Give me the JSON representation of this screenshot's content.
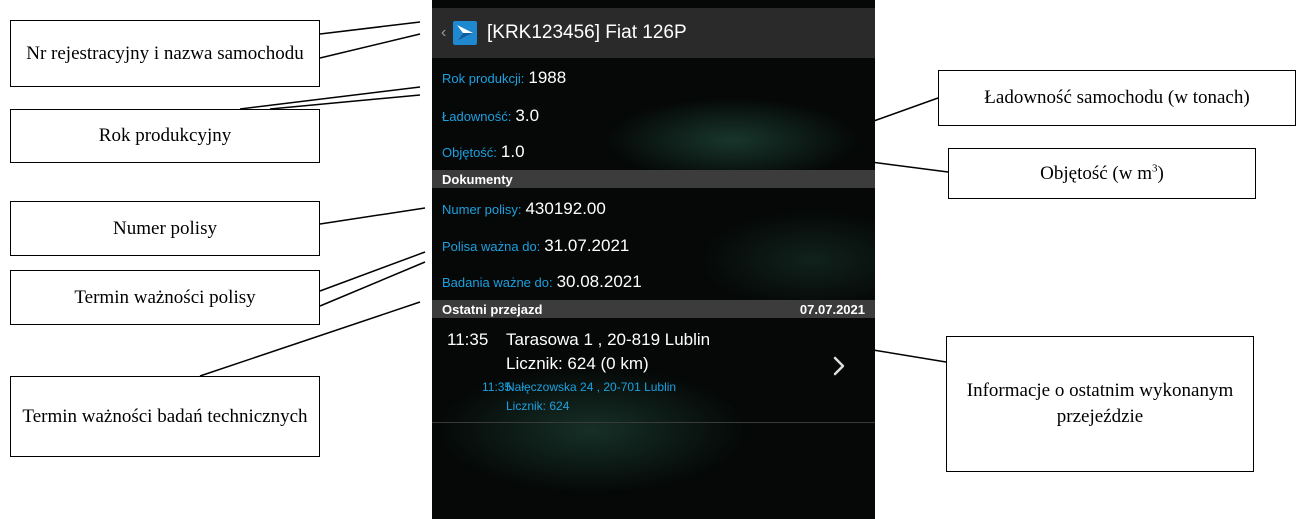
{
  "callouts": {
    "registration": "Nr rejestracyjny i nazwa samochodu",
    "production_year": "Rok produkcyjny",
    "load_capacity": "Ładowność samochodu (w tonach)",
    "volume_prefix": "Objętość (w m",
    "volume_sup": "3",
    "volume_suffix": ")",
    "policy_number": "Numer polisy",
    "policy_validity": "Termin ważności polisy",
    "inspection_validity": "Termin ważności badań technicznych",
    "last_trip": "Informacje o ostatnim wykonanym przejeździe"
  },
  "appbar": {
    "back_icon": "chevron-left-icon",
    "logo_icon": "app-logo-icon",
    "title": "[KRK123456] Fiat 126P"
  },
  "vehicle": {
    "year_label": "Rok produkcji:",
    "year_value": "1988",
    "load_label": "Ładowność:",
    "load_value": "3.0",
    "volume_label": "Objętość:",
    "volume_value": "1.0"
  },
  "documents": {
    "header": "Dokumenty",
    "policy_number_label": "Numer polisy:",
    "policy_number_value": "430192.00",
    "policy_valid_label": "Polisa ważna do:",
    "policy_valid_value": "31.07.2021",
    "inspection_label": "Badania ważne do:",
    "inspection_value": "30.08.2021"
  },
  "last_trip": {
    "header": "Ostatni przejazd",
    "date": "07.07.2021",
    "start_time": "11:35",
    "start_address": "Tarasowa 1 , 20-819 Lublin",
    "start_counter": "Licznik: 624 (0 km)",
    "end_time": "11:35",
    "end_address": "Nałęczowska 24 , 20-701 Lublin",
    "end_counter": "Licznik: 624",
    "chevron_icon": "chevron-right-icon"
  },
  "colors": {
    "accent_blue": "#1da0e0",
    "appbar_bg": "#2a2a2a",
    "section_bg": "#3c3c3c",
    "screen_bg": "#050807"
  }
}
